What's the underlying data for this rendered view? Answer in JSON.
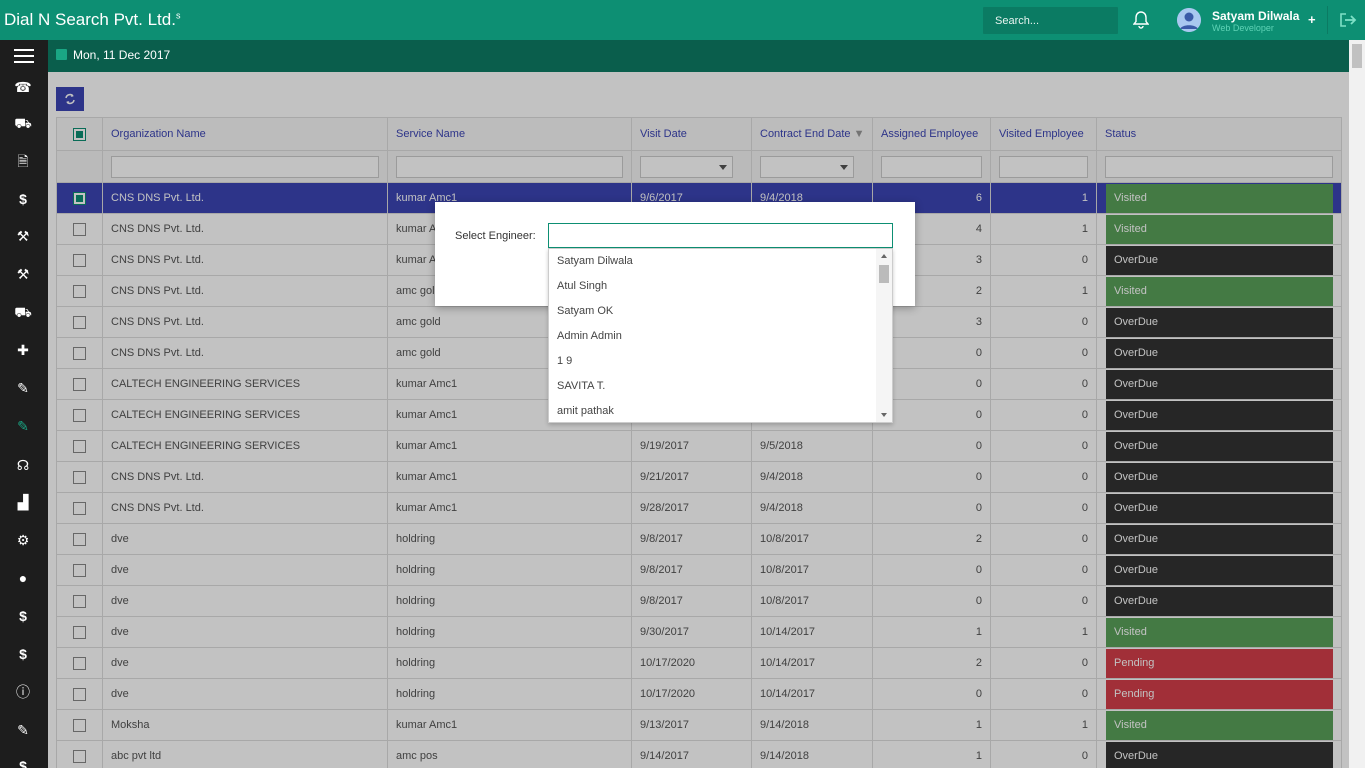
{
  "header": {
    "brand": "Dial N Search Pvt. Ltd.",
    "brand_sup": "s",
    "search_placeholder": "Search...",
    "user_name": "Satyam Dilwala",
    "user_role": "Web Developer",
    "accent": "#0d8f73"
  },
  "subbar": {
    "date": "Mon, 11 Dec 2017"
  },
  "sidebar": {
    "icons": [
      "phone-icon",
      "basket-icon",
      "pdf-icon",
      "dollar-icon",
      "gavel-icon",
      "gavel-icon",
      "truck-icon",
      "puzzle-icon",
      "wrench-icon",
      "wrench-icon",
      "headphones-icon",
      "chart-icon",
      "gears-icon",
      "user-icon",
      "dollar-icon",
      "dollar-icon",
      "info-icon",
      "wrench-icon",
      "dollar-icon"
    ]
  },
  "grid": {
    "columns": [
      "Organization Name",
      "Service Name",
      "Visit Date",
      "Contract End Date",
      "Assigned Employee",
      "Visited Employee",
      "Status"
    ],
    "rows": [
      [
        "CNS DNS Pvt. Ltd.",
        "kumar Amc1",
        "9/6/2017",
        "9/4/2018",
        "6",
        "1",
        "Visited"
      ],
      [
        "CNS DNS Pvt. Ltd.",
        "kumar A",
        "",
        "",
        "4",
        "1",
        "Visited"
      ],
      [
        "CNS DNS Pvt. Ltd.",
        "kumar A",
        "",
        "",
        "3",
        "0",
        "OverDue"
      ],
      [
        "CNS DNS Pvt. Ltd.",
        "amc gol",
        "",
        "",
        "2",
        "1",
        "Visited"
      ],
      [
        "CNS DNS Pvt. Ltd.",
        "amc gold",
        "",
        "",
        "3",
        "0",
        "OverDue"
      ],
      [
        "CNS DNS Pvt. Ltd.",
        "amc gold",
        "",
        "",
        "0",
        "0",
        "OverDue"
      ],
      [
        "CALTECH ENGINEERING SERVICES",
        "kumar Amc1",
        "",
        "",
        "0",
        "0",
        "OverDue"
      ],
      [
        "CALTECH ENGINEERING SERVICES",
        "kumar Amc1",
        "",
        "",
        "0",
        "0",
        "OverDue"
      ],
      [
        "CALTECH ENGINEERING SERVICES",
        "kumar Amc1",
        "9/19/2017",
        "9/5/2018",
        "0",
        "0",
        "OverDue"
      ],
      [
        "CNS DNS Pvt. Ltd.",
        "kumar Amc1",
        "9/21/2017",
        "9/4/2018",
        "0",
        "0",
        "OverDue"
      ],
      [
        "CNS DNS Pvt. Ltd.",
        "kumar Amc1",
        "9/28/2017",
        "9/4/2018",
        "0",
        "0",
        "OverDue"
      ],
      [
        "dve",
        "holdring",
        "9/8/2017",
        "10/8/2017",
        "2",
        "0",
        "OverDue"
      ],
      [
        "dve",
        "holdring",
        "9/8/2017",
        "10/8/2017",
        "0",
        "0",
        "OverDue"
      ],
      [
        "dve",
        "holdring",
        "9/8/2017",
        "10/8/2017",
        "0",
        "0",
        "OverDue"
      ],
      [
        "dve",
        "holdring",
        "9/30/2017",
        "10/14/2017",
        "1",
        "1",
        "Visited"
      ],
      [
        "dve",
        "holdring",
        "10/17/2020",
        "10/14/2017",
        "2",
        "0",
        "Pending"
      ],
      [
        "dve",
        "holdring",
        "10/17/2020",
        "10/14/2017",
        "0",
        "0",
        "Pending"
      ],
      [
        "Moksha",
        "kumar Amc1",
        "9/13/2017",
        "9/14/2018",
        "1",
        "1",
        "Visited"
      ],
      [
        "abc pvt ltd",
        "amc pos",
        "9/14/2017",
        "9/14/2018",
        "1",
        "0",
        "OverDue"
      ]
    ]
  },
  "dialog": {
    "label": "Select Engineer:",
    "options": [
      "Satyam Dilwala",
      "Atul Singh",
      "Satyam OK",
      "Admin Admin",
      "1 9",
      "SAVITA T.",
      "amit pathak"
    ]
  }
}
